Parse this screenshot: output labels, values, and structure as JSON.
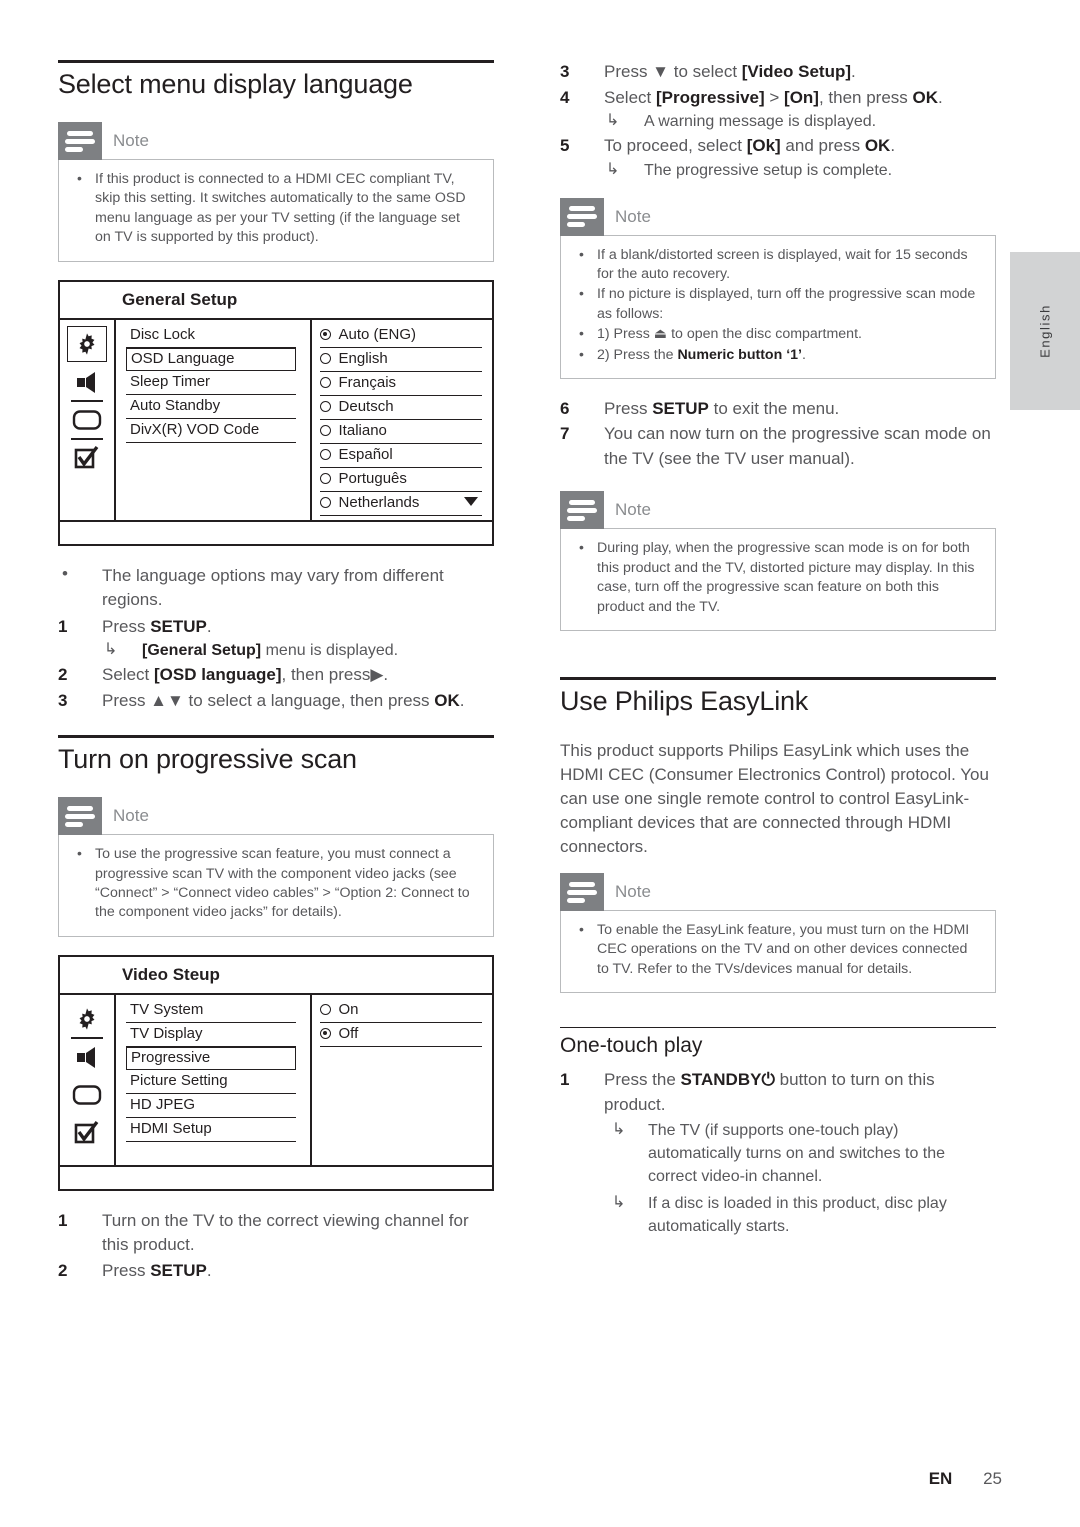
{
  "page": {
    "language_tab": "English",
    "footer_marker": "EN",
    "footer_page": "25"
  },
  "left_column": {
    "heading": "Select menu display language",
    "note1": {
      "title": "Note",
      "bullets": [
        "If this product is connected to a HDMI CEC compliant TV, skip this setting. It switches automatically to the same OSD menu language as per your TV setting (if the language set on TV is supported by this product)."
      ]
    },
    "general_setup_menu": {
      "title": "General Setup",
      "icons": [
        "gear-icon",
        "speaker-icon",
        "tv-icon",
        "checkbox-icon"
      ],
      "items": [
        "Disc Lock",
        "OSD Language",
        "Sleep Timer",
        "Auto Standby",
        "DivX(R) VOD Code"
      ],
      "highlighted_item": "OSD Language",
      "options": [
        "Auto (ENG)",
        "English",
        "Français",
        "Deutsch",
        "Italiano",
        "Español",
        "Português",
        "Netherlands"
      ],
      "selected_option": "Auto (ENG)",
      "has_more_indicator": true
    },
    "bullet_note": "The language options may vary from different regions.",
    "steps_language": [
      {
        "num": "1",
        "text_html": "Press <b>SETUP</b>.",
        "sub": "<b>[General Setup]</b> menu is displayed."
      },
      {
        "num": "2",
        "text_html": "Select <b>[OSD language]</b>, then press▶."
      },
      {
        "num": "3",
        "text_html": "Press ▲▼ to select a language, then press <b>OK</b>."
      }
    ],
    "heading2": "Turn on progressive scan",
    "note2": {
      "title": "Note",
      "bullets": [
        "To use the progressive scan feature, you must connect a progressive scan TV with the component video jacks (see “Connect” > “Connect video cables” > “Option 2: Connect to the component video jacks” for details)."
      ]
    },
    "video_setup_menu": {
      "title": "Video Steup",
      "icons": [
        "gear-icon",
        "speaker-icon",
        "tv-icon",
        "checkbox-icon"
      ],
      "items": [
        "TV System",
        "TV Display",
        "Progressive",
        "Picture Setting",
        "HD JPEG",
        "HDMI Setup"
      ],
      "highlighted_item": "Progressive",
      "options": [
        "On",
        "Off"
      ],
      "selected_option": "Off"
    },
    "steps_progressive": [
      {
        "num": "1",
        "text_html": "Turn on the TV to the correct viewing channel for this product."
      },
      {
        "num": "2",
        "text_html": "Press <b>SETUP</b>."
      }
    ]
  },
  "right_column": {
    "steps_progressive_cont": [
      {
        "num": "3",
        "text_html": "Press ▼ to select <b>[Video Setup]</b>."
      },
      {
        "num": "4",
        "text_html": "Select <b>[Progressive]</b> > <b>[On]</b>, then press <b>OK</b>.",
        "sub": "A warning message is displayed."
      },
      {
        "num": "5",
        "text_html": "To proceed, select <b>[Ok]</b> and press <b>OK</b>.",
        "sub": "The progressive setup is complete."
      }
    ],
    "note3": {
      "title": "Note",
      "bullets_html": [
        "If a blank/distorted screen is displayed, wait for 15 seconds for the auto recovery.",
        "If no picture is displayed, turn off the progressive scan mode as follows:",
        "1) Press ⏏ to open the disc compartment.",
        "2) Press the <b>Numeric button ‘1’</b>."
      ]
    },
    "steps_progressive_end": [
      {
        "num": "6",
        "text_html": "Press <b>SETUP</b> to exit the menu."
      },
      {
        "num": "7",
        "text_html": "You can now turn on the progressive scan mode on the TV (see the TV user manual)."
      }
    ],
    "note4": {
      "title": "Note",
      "bullets": [
        "During play, when the progressive scan mode is on for both this product and the TV, distorted picture may display. In this case, turn off the progressive scan feature on both this product and the TV."
      ]
    },
    "heading_easylink": "Use Philips EasyLink",
    "easylink_body": "This product supports Philips EasyLink which uses the HDMI CEC (Consumer Electronics Control) protocol. You can use one single remote control to control EasyLink-compliant devices that are connected through HDMI connectors.",
    "note5": {
      "title": "Note",
      "bullets": [
        "To enable the EasyLink feature, you must turn on the HDMI CEC operations on the TV and on other devices connected to TV. Refer to the TVs/devices manual for details."
      ]
    },
    "heading_onetouch": "One-touch play",
    "onetouch_steps": [
      {
        "num": "1",
        "text_html": "Press the <b>STANDBY⏻</b> button to turn on this product.",
        "subs": [
          "The TV (if supports one-touch play) automatically turns on and switches to the correct video-in channel.",
          "If a disc is loaded in this product, disc play automatically starts."
        ]
      }
    ]
  }
}
